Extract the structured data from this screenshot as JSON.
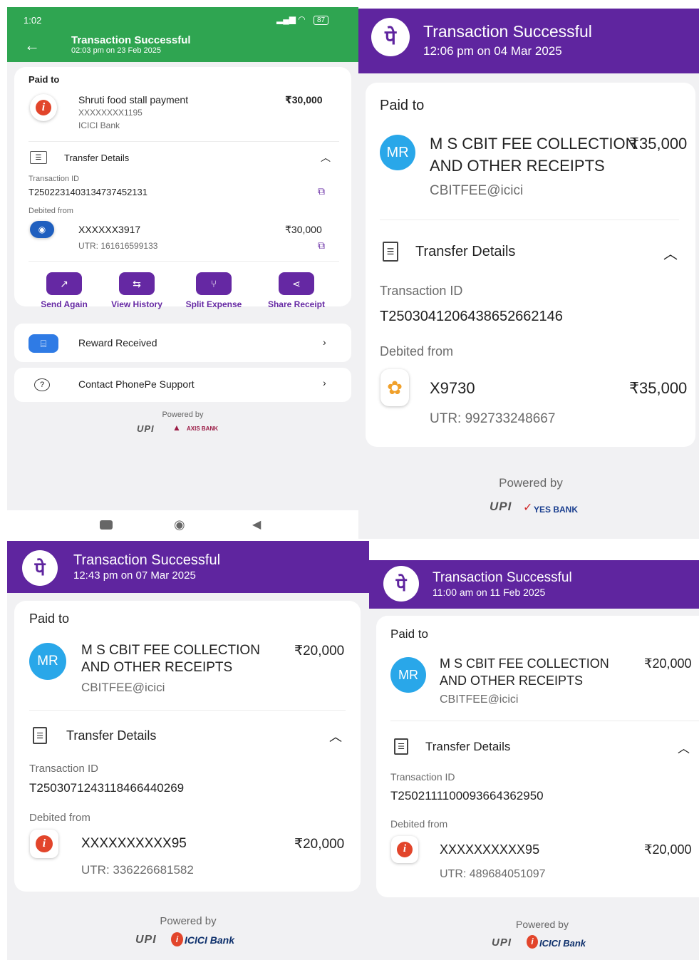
{
  "s1": {
    "status_bar": {
      "time": "1:02",
      "battery": "87"
    },
    "header": {
      "title": "Transaction Successful",
      "subtitle": "02:03 pm on 23 Feb 2025",
      "color": "#2fa551"
    },
    "paid_to_label": "Paid to",
    "payee": {
      "name": "Shruti food stall payment",
      "account": "XXXXXXXX1195",
      "bank": "ICICI Bank",
      "amount": "₹30,000"
    },
    "transfer_details_label": "Transfer Details",
    "transaction_id_label": "Transaction ID",
    "transaction_id": "T2502231403134737452131",
    "debited_from_label": "Debited from",
    "debit_account": "XXXXXX3917",
    "debit_amount": "₹30,000",
    "utr": "UTR: 161616599133",
    "actions": [
      "Send Again",
      "View History",
      "Split Expense",
      "Share Receipt"
    ],
    "reward_label": "Reward Received",
    "support_label": "Contact PhonePe Support",
    "powered_by": "Powered by",
    "upi": "UPI",
    "partner_bank": "AXIS BANK"
  },
  "s2": {
    "logo": "पे",
    "header": {
      "title": "Transaction Successful",
      "subtitle": "12:06 pm on 04 Mar 2025"
    },
    "paid_to_label": "Paid to",
    "avatar": "MR",
    "payee": {
      "name_line1": "M S CBIT FEE COLLECTION",
      "name_line2": "AND OTHER RECEIPTS",
      "upi": "CBITFEE@icici",
      "amount": "₹35,000"
    },
    "transfer_details_label": "Transfer Details",
    "transaction_id_label": "Transaction ID",
    "transaction_id": "T2503041206438652662146",
    "debited_from_label": "Debited from",
    "debit_account": "X9730",
    "debit_amount": "₹35,000",
    "utr": "UTR: 992733248667",
    "powered_by": "Powered by",
    "upi": "UPI",
    "partner_bank": "YES BANK"
  },
  "s3": {
    "logo": "पे",
    "header": {
      "title": "Transaction Successful",
      "subtitle": "12:43 pm on 07 Mar 2025"
    },
    "paid_to_label": "Paid to",
    "avatar": "MR",
    "payee": {
      "name_line1": "M S CBIT FEE COLLECTION",
      "name_line2": "AND OTHER RECEIPTS",
      "upi": "CBITFEE@icici",
      "amount": "₹20,000"
    },
    "transfer_details_label": "Transfer Details",
    "transaction_id_label": "Transaction ID",
    "transaction_id": "T2503071243118466440269",
    "debited_from_label": "Debited from",
    "debit_account": "XXXXXXXXXX95",
    "debit_amount": "₹20,000",
    "utr": "UTR: 336226681582",
    "powered_by": "Powered by",
    "upi": "UPI",
    "partner_bank": "ICICI Bank"
  },
  "s4": {
    "logo": "पे",
    "header": {
      "title": "Transaction Successful",
      "subtitle": "11:00 am on 11 Feb 2025"
    },
    "paid_to_label": "Paid to",
    "avatar": "MR",
    "payee": {
      "name_line1": "M S CBIT FEE COLLECTION",
      "name_line2": "AND OTHER RECEIPTS",
      "upi": "CBITFEE@icici",
      "amount": "₹20,000"
    },
    "transfer_details_label": "Transfer Details",
    "transaction_id_label": "Transaction ID",
    "transaction_id": "T2502111100093664362950",
    "debited_from_label": "Debited from",
    "debit_account": "XXXXXXXXXX95",
    "debit_amount": "₹20,000",
    "utr": "UTR: 489684051097",
    "powered_by": "Powered by",
    "upi": "UPI",
    "partner_bank": "ICICI Bank"
  },
  "colors": {
    "phonepe_purple": "#5f259f",
    "success_green": "#2fa551",
    "avatar_blue": "#29a7e9",
    "icici_red": "#e2452b"
  }
}
